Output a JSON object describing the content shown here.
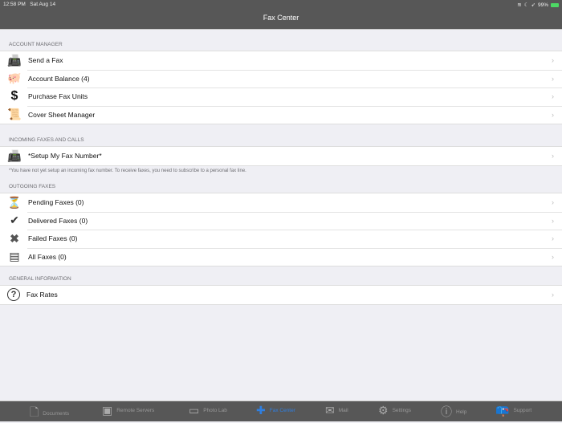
{
  "status": {
    "time": "12:58 PM",
    "date": "Sat Aug 14",
    "battery": "99%"
  },
  "header": {
    "title": "Fax Center"
  },
  "sections": [
    {
      "title": "ACCOUNT MANAGER",
      "items": [
        {
          "label": "Send a Fax",
          "icon": "fax-machine-icon"
        },
        {
          "label": "Account Balance (4)",
          "icon": "piggy-bank-icon"
        },
        {
          "label": "Purchase Fax Units",
          "icon": "dollar-icon"
        },
        {
          "label": "Cover Sheet Manager",
          "icon": "scroll-icon"
        }
      ]
    },
    {
      "title": "INCOMING FAXES AND CALLS",
      "items": [
        {
          "label": "*Setup My Fax Number*",
          "icon": "fax-machine-icon"
        }
      ],
      "note": "*You have not yet setup an incoming fax number. To receive faxes, you need to subscribe to a personal fax line."
    },
    {
      "title": "OUTGOING FAXES",
      "items": [
        {
          "label": "Pending Faxes (0)",
          "icon": "pending-icon"
        },
        {
          "label": "Delivered Faxes (0)",
          "icon": "checkmark-icon"
        },
        {
          "label": "Failed Faxes (0)",
          "icon": "x-icon"
        },
        {
          "label": "All Faxes (0)",
          "icon": "list-icon"
        }
      ]
    },
    {
      "title": "GENERAL INFORMATION",
      "items": [
        {
          "label": "Fax Rates",
          "icon": "question-icon"
        }
      ]
    }
  ],
  "tabs": [
    {
      "label": "Documents"
    },
    {
      "label": "Remote Servers"
    },
    {
      "label": "Photo Lab"
    },
    {
      "label": "Fax Center",
      "active": true
    },
    {
      "label": "Mail"
    },
    {
      "label": "Settings"
    },
    {
      "label": "Help"
    },
    {
      "label": "Support"
    }
  ]
}
